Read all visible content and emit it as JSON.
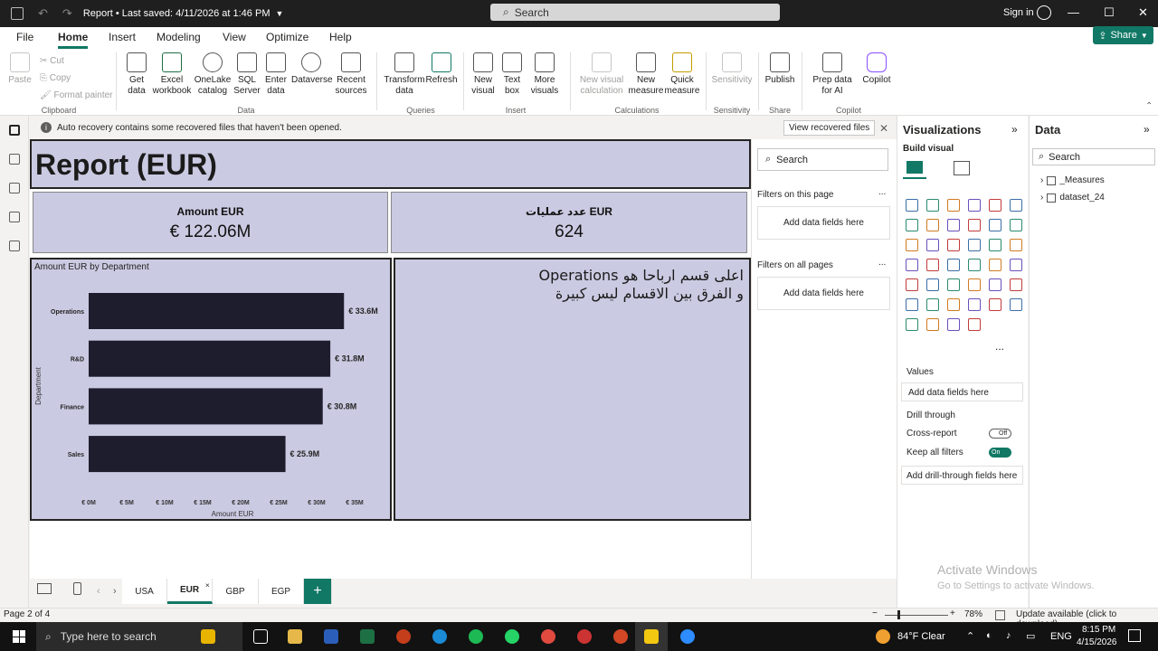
{
  "titlebar": {
    "title": "Report • Last saved: 4/11/2026 at 1:46 PM",
    "search_placeholder": "Search",
    "signin": "Sign in"
  },
  "menu": {
    "items": [
      "File",
      "Home",
      "Insert",
      "Modeling",
      "View",
      "Optimize",
      "Help"
    ],
    "active": "Home",
    "share": "Share"
  },
  "ribbon": {
    "clipboard": {
      "paste": "Paste",
      "cut": "Cut",
      "copy": "Copy",
      "format_painter": "Format painter",
      "label": "Clipboard"
    },
    "data": {
      "get_data": "Get data",
      "excel": "Excel workbook",
      "onelake": "OneLake catalog",
      "sql": "SQL Server",
      "enter_data": "Enter data",
      "dataverse": "Dataverse",
      "recent": "Recent sources",
      "label": "Data"
    },
    "queries": {
      "transform": "Transform data",
      "refresh": "Refresh",
      "label": "Queries"
    },
    "insert": {
      "new_visual": "New visual",
      "text_box": "Text box",
      "more_visuals": "More visuals",
      "label": "Insert"
    },
    "calculations": {
      "new_visual_calc": "New visual calculation",
      "new_measure": "New measure",
      "quick_measure": "Quick measure",
      "label": "Calculations"
    },
    "sensitivity": {
      "sensitivity": "Sensitivity",
      "label": "Sensitivity"
    },
    "share": {
      "publish": "Publish",
      "label": "Share"
    },
    "copilot": {
      "prep": "Prep data for AI",
      "copilot": "Copilot",
      "label": "Copilot"
    }
  },
  "notice": {
    "text": "Auto recovery contains some recovered files that haven't been opened.",
    "button": "View recovered files"
  },
  "report": {
    "title": "Report (EUR)",
    "card1": {
      "label": "Amount EUR",
      "value": "€ 122.06M"
    },
    "card2": {
      "label": "عدد عمليات EUR",
      "value": "624"
    },
    "textbox": {
      "line1": "اعلى قسم ارباحا هو Operations",
      "line2": "و الفرق بين الاقسام ليس كبيرة"
    }
  },
  "chart_data": {
    "type": "bar",
    "title": "Amount EUR by Department",
    "xlabel": "Amount EUR",
    "ylabel": "Department",
    "categories": [
      "Operations",
      "R&D",
      "Finance",
      "Sales"
    ],
    "values": [
      33.6,
      31.8,
      30.8,
      25.9
    ],
    "data_labels": [
      "€ 33.6M",
      "€ 31.8M",
      "€ 30.8M",
      "€ 25.9M"
    ],
    "xlim": [
      0,
      35
    ],
    "x_ticks": [
      "€ 0M",
      "€ 5M",
      "€ 10M",
      "€ 15M",
      "€ 20M",
      "€ 25M",
      "€ 30M",
      "€ 35M"
    ],
    "bar_color": "#1e1d2e",
    "orientation": "horizontal"
  },
  "filters": {
    "search": "Search",
    "on_page": "Filters on this page",
    "on_all": "Filters on all pages",
    "add": "Add data fields here",
    "dots": "..."
  },
  "viz": {
    "title": "Visualizations",
    "build": "Build visual",
    "values": "Values",
    "add_values": "Add data fields here",
    "drill": "Drill through",
    "cross": "Cross-report",
    "cross_state": "Off",
    "keep": "Keep all filters",
    "keep_state": "On",
    "add_drill": "Add drill-through fields here",
    "more": "..."
  },
  "datapane": {
    "title": "Data",
    "search": "Search",
    "items": [
      "_Measures",
      "dataset_24"
    ]
  },
  "tabs": {
    "items": [
      "USA",
      "EUR",
      "GBP",
      "EGP"
    ],
    "active": "EUR",
    "add": "+"
  },
  "status": {
    "page": "Page 2 of 4",
    "zoom": "78%",
    "update": "Update available (click to download)"
  },
  "watermark": {
    "line1": "Activate Windows",
    "line2": "Go to Settings to activate Windows."
  },
  "taskbar": {
    "search": "Type here to search",
    "weather": "84°F  Clear",
    "lang": "ENG",
    "time": "8:15 PM",
    "date": "4/15/2026"
  },
  "colors": {
    "accent": "#117865",
    "visual_bg": "#cacae2",
    "bar": "#1e1d2e"
  }
}
